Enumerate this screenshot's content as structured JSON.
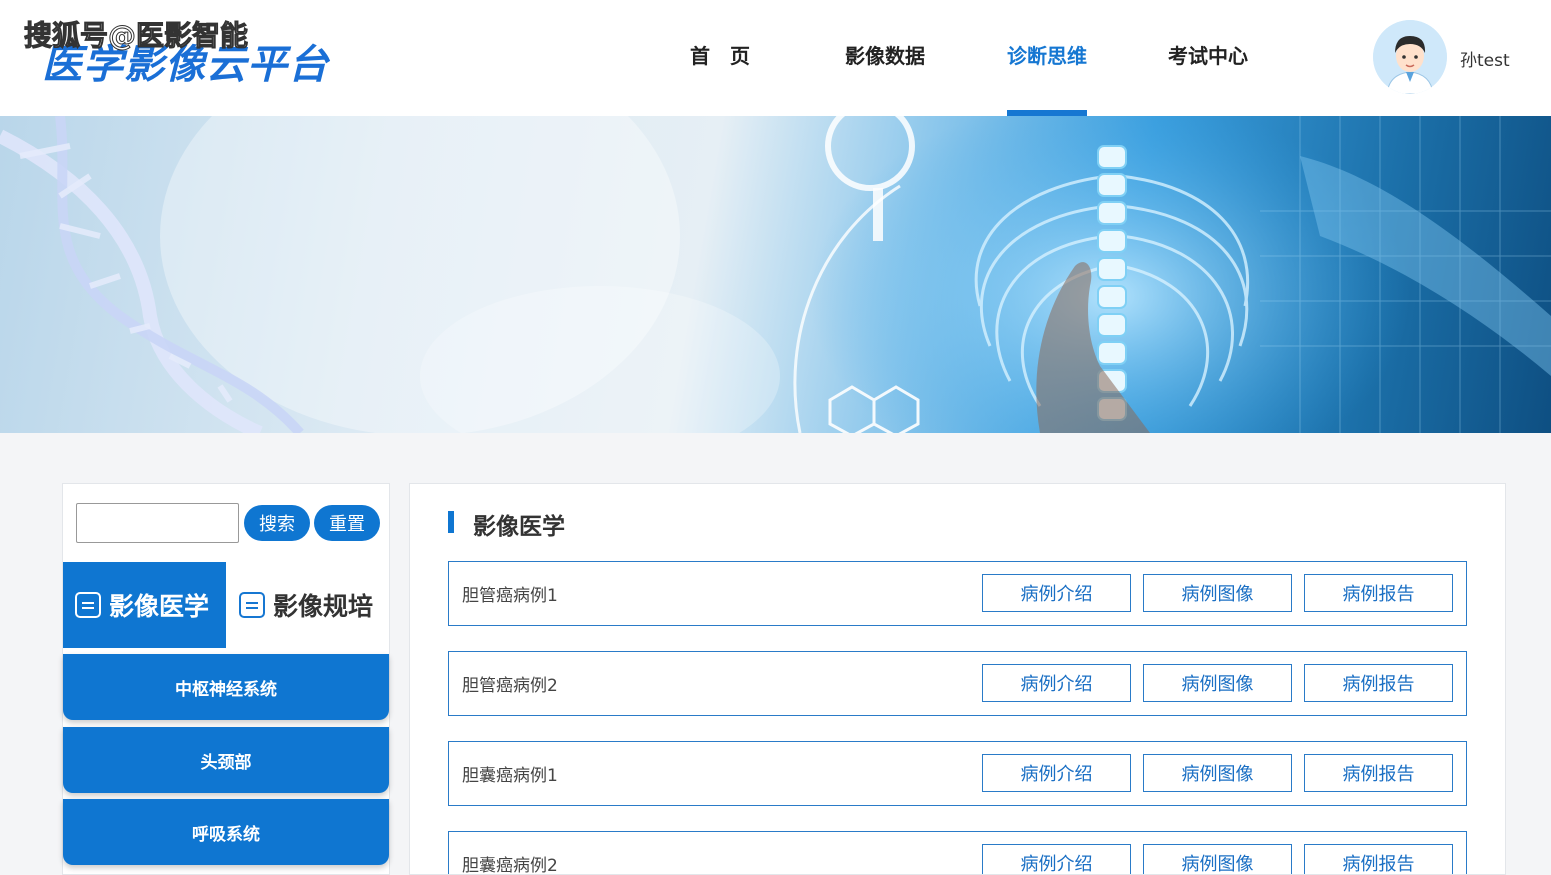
{
  "watermark": "搜狐号@医影智能",
  "header": {
    "logo": "医学影像云平台",
    "nav": [
      {
        "label": "首　页"
      },
      {
        "label": "影像数据"
      },
      {
        "label": "诊断思维"
      },
      {
        "label": "考试中心"
      }
    ],
    "active_nav": "诊断思维",
    "username": "孙test"
  },
  "sidebar": {
    "search_value": "",
    "search_button": "搜索",
    "reset_button": "重置",
    "category_tabs": [
      {
        "label": "影像医学",
        "active": true
      },
      {
        "label": "影像规培",
        "active": false
      }
    ],
    "systems": [
      "中枢神经系统",
      "头颈部",
      "呼吸系统"
    ]
  },
  "main": {
    "section_title": "影像医学",
    "cases": [
      {
        "name": "胆管癌病例1",
        "actions": [
          "病例介绍",
          "病例图像",
          "病例报告"
        ]
      },
      {
        "name": "胆管癌病例2",
        "actions": [
          "病例介绍",
          "病例图像",
          "病例报告"
        ]
      },
      {
        "name": "胆囊癌病例1",
        "actions": [
          "病例介绍",
          "病例图像",
          "病例报告"
        ]
      },
      {
        "name": "胆囊癌病例2",
        "actions": [
          "病例介绍",
          "病例图像",
          "病例报告"
        ]
      }
    ]
  },
  "colors": {
    "primary": "#0f76d1",
    "nav_active": "#1677d2",
    "row_border": "#2a7bc8",
    "page_bg": "#f4f5f7"
  }
}
